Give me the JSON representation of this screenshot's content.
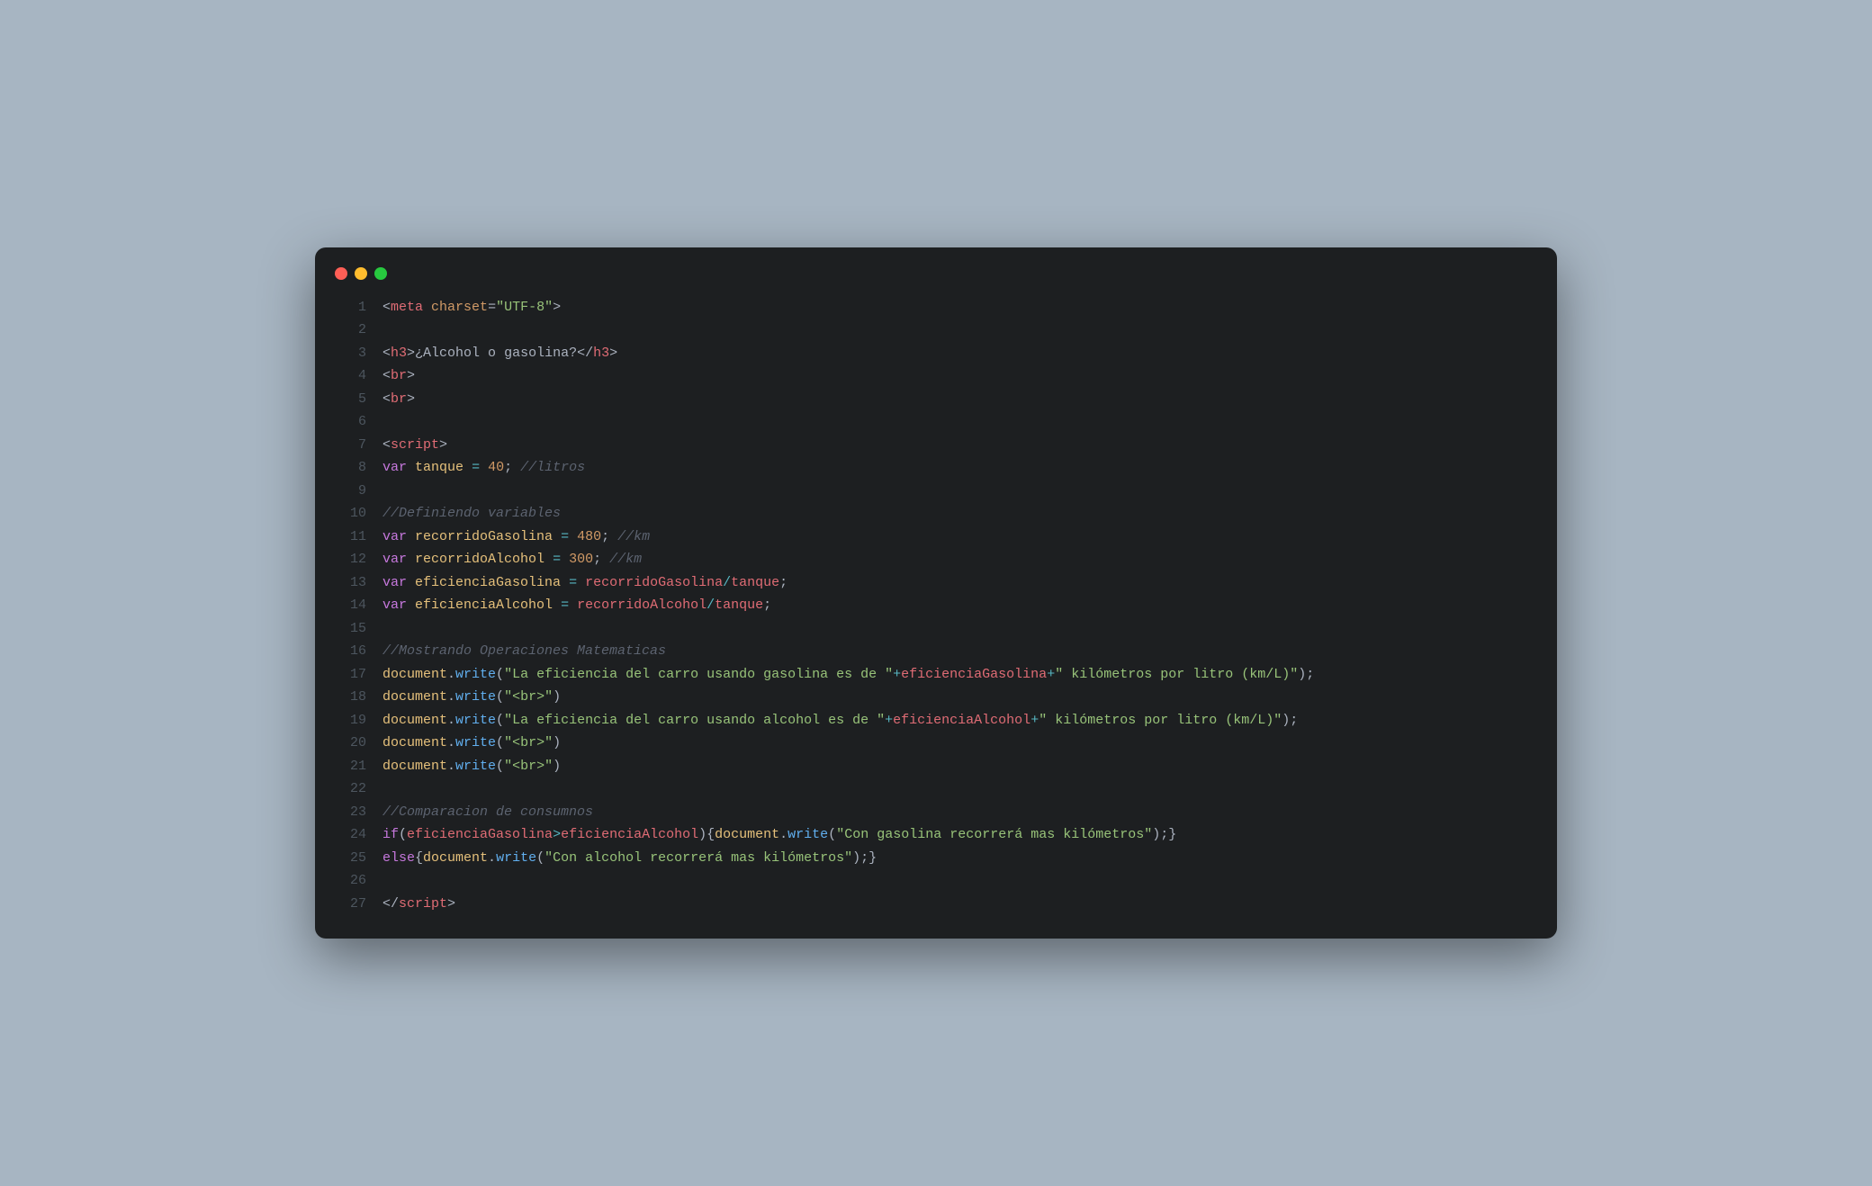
{
  "window": {
    "buttons": [
      "close",
      "minimize",
      "zoom"
    ]
  },
  "code": {
    "lines": [
      {
        "n": 1,
        "t": [
          [
            "br",
            "<"
          ],
          [
            "tg",
            "meta"
          ],
          [
            "p",
            " "
          ],
          [
            "at",
            "charset"
          ],
          [
            "eq",
            "="
          ],
          [
            "st",
            "\"UTF-8\""
          ],
          [
            "br",
            ">"
          ]
        ]
      },
      {
        "n": 2,
        "t": []
      },
      {
        "n": 3,
        "t": [
          [
            "br",
            "<"
          ],
          [
            "tg",
            "h3"
          ],
          [
            "br",
            ">"
          ],
          [
            "tx",
            "¿Alcohol o gasolina?"
          ],
          [
            "br",
            "</"
          ],
          [
            "tg",
            "h3"
          ],
          [
            "br",
            ">"
          ]
        ]
      },
      {
        "n": 4,
        "t": [
          [
            "br",
            "<"
          ],
          [
            "tg",
            "br"
          ],
          [
            "br",
            ">"
          ]
        ]
      },
      {
        "n": 5,
        "t": [
          [
            "br",
            "<"
          ],
          [
            "tg",
            "br"
          ],
          [
            "br",
            ">"
          ]
        ]
      },
      {
        "n": 6,
        "t": []
      },
      {
        "n": 7,
        "t": [
          [
            "br",
            "<"
          ],
          [
            "tg",
            "script"
          ],
          [
            "br",
            ">"
          ]
        ]
      },
      {
        "n": 8,
        "t": [
          [
            "kw",
            "var"
          ],
          [
            "p",
            " "
          ],
          [
            "vr",
            "tanque"
          ],
          [
            "p",
            " "
          ],
          [
            "op",
            "="
          ],
          [
            "p",
            " "
          ],
          [
            "nm",
            "40"
          ],
          [
            "p",
            "; "
          ],
          [
            "cm",
            "//litros"
          ]
        ]
      },
      {
        "n": 9,
        "t": []
      },
      {
        "n": 10,
        "t": [
          [
            "cm",
            "//Definiendo variables"
          ]
        ]
      },
      {
        "n": 11,
        "t": [
          [
            "kw",
            "var"
          ],
          [
            "p",
            " "
          ],
          [
            "vr",
            "recorridoGasolina"
          ],
          [
            "p",
            " "
          ],
          [
            "op",
            "="
          ],
          [
            "p",
            " "
          ],
          [
            "nm",
            "480"
          ],
          [
            "p",
            "; "
          ],
          [
            "cm",
            "//km"
          ]
        ]
      },
      {
        "n": 12,
        "t": [
          [
            "kw",
            "var"
          ],
          [
            "p",
            " "
          ],
          [
            "vr",
            "recorridoAlcohol"
          ],
          [
            "p",
            " "
          ],
          [
            "op",
            "="
          ],
          [
            "p",
            " "
          ],
          [
            "nm",
            "300"
          ],
          [
            "p",
            "; "
          ],
          [
            "cm",
            "//km"
          ]
        ]
      },
      {
        "n": 13,
        "t": [
          [
            "kw",
            "var"
          ],
          [
            "p",
            " "
          ],
          [
            "vr",
            "eficienciaGasolina"
          ],
          [
            "p",
            " "
          ],
          [
            "op",
            "="
          ],
          [
            "p",
            " "
          ],
          [
            "id",
            "recorridoGasolina"
          ],
          [
            "op",
            "/"
          ],
          [
            "id",
            "tanque"
          ],
          [
            "p",
            ";"
          ]
        ]
      },
      {
        "n": 14,
        "t": [
          [
            "kw",
            "var"
          ],
          [
            "p",
            " "
          ],
          [
            "vr",
            "eficienciaAlcohol"
          ],
          [
            "p",
            " "
          ],
          [
            "op",
            "="
          ],
          [
            "p",
            " "
          ],
          [
            "id",
            "recorridoAlcohol"
          ],
          [
            "op",
            "/"
          ],
          [
            "id",
            "tanque"
          ],
          [
            "p",
            ";"
          ]
        ]
      },
      {
        "n": 15,
        "t": []
      },
      {
        "n": 16,
        "t": [
          [
            "cm",
            "//Mostrando Operaciones Matematicas"
          ]
        ]
      },
      {
        "n": 17,
        "t": [
          [
            "ob",
            "document"
          ],
          [
            "p",
            "."
          ],
          [
            "fn",
            "write"
          ],
          [
            "p",
            "("
          ],
          [
            "st",
            "\"La eficiencia del carro usando gasolina es de \""
          ],
          [
            "op",
            "+"
          ],
          [
            "id",
            "eficienciaGasolina"
          ],
          [
            "op",
            "+"
          ],
          [
            "st",
            "\" kilómetros por litro (km/L)\""
          ],
          [
            "p",
            ");"
          ]
        ]
      },
      {
        "n": 18,
        "t": [
          [
            "ob",
            "document"
          ],
          [
            "p",
            "."
          ],
          [
            "fn",
            "write"
          ],
          [
            "p",
            "("
          ],
          [
            "st",
            "\"<br>\""
          ],
          [
            "p",
            ")"
          ]
        ]
      },
      {
        "n": 19,
        "t": [
          [
            "ob",
            "document"
          ],
          [
            "p",
            "."
          ],
          [
            "fn",
            "write"
          ],
          [
            "p",
            "("
          ],
          [
            "st",
            "\"La eficiencia del carro usando alcohol es de \""
          ],
          [
            "op",
            "+"
          ],
          [
            "id",
            "eficienciaAlcohol"
          ],
          [
            "op",
            "+"
          ],
          [
            "st",
            "\" kilómetros por litro (km/L)\""
          ],
          [
            "p",
            ");"
          ]
        ]
      },
      {
        "n": 20,
        "t": [
          [
            "ob",
            "document"
          ],
          [
            "p",
            "."
          ],
          [
            "fn",
            "write"
          ],
          [
            "p",
            "("
          ],
          [
            "st",
            "\"<br>\""
          ],
          [
            "p",
            ")"
          ]
        ]
      },
      {
        "n": 21,
        "t": [
          [
            "ob",
            "document"
          ],
          [
            "p",
            "."
          ],
          [
            "fn",
            "write"
          ],
          [
            "p",
            "("
          ],
          [
            "st",
            "\"<br>\""
          ],
          [
            "p",
            ")"
          ]
        ]
      },
      {
        "n": 22,
        "t": []
      },
      {
        "n": 23,
        "t": [
          [
            "cm",
            "//Comparacion de consumnos"
          ]
        ]
      },
      {
        "n": 24,
        "t": [
          [
            "kw",
            "if"
          ],
          [
            "p",
            "("
          ],
          [
            "id",
            "eficienciaGasolina"
          ],
          [
            "op",
            ">"
          ],
          [
            "id",
            "eficienciaAlcohol"
          ],
          [
            "p",
            "){"
          ],
          [
            "ob",
            "document"
          ],
          [
            "p",
            "."
          ],
          [
            "fn",
            "write"
          ],
          [
            "p",
            "("
          ],
          [
            "st",
            "\"Con gasolina recorrerá mas kilómetros\""
          ],
          [
            "p",
            ");}"
          ]
        ]
      },
      {
        "n": 25,
        "t": [
          [
            "kw",
            "else"
          ],
          [
            "p",
            "{"
          ],
          [
            "ob",
            "document"
          ],
          [
            "p",
            "."
          ],
          [
            "fn",
            "write"
          ],
          [
            "p",
            "("
          ],
          [
            "st",
            "\"Con alcohol recorrerá mas kilómetros\""
          ],
          [
            "p",
            ");}"
          ]
        ]
      },
      {
        "n": 26,
        "t": []
      },
      {
        "n": 27,
        "t": [
          [
            "br",
            "</"
          ],
          [
            "tg",
            "script"
          ],
          [
            "br",
            ">"
          ]
        ]
      }
    ]
  }
}
